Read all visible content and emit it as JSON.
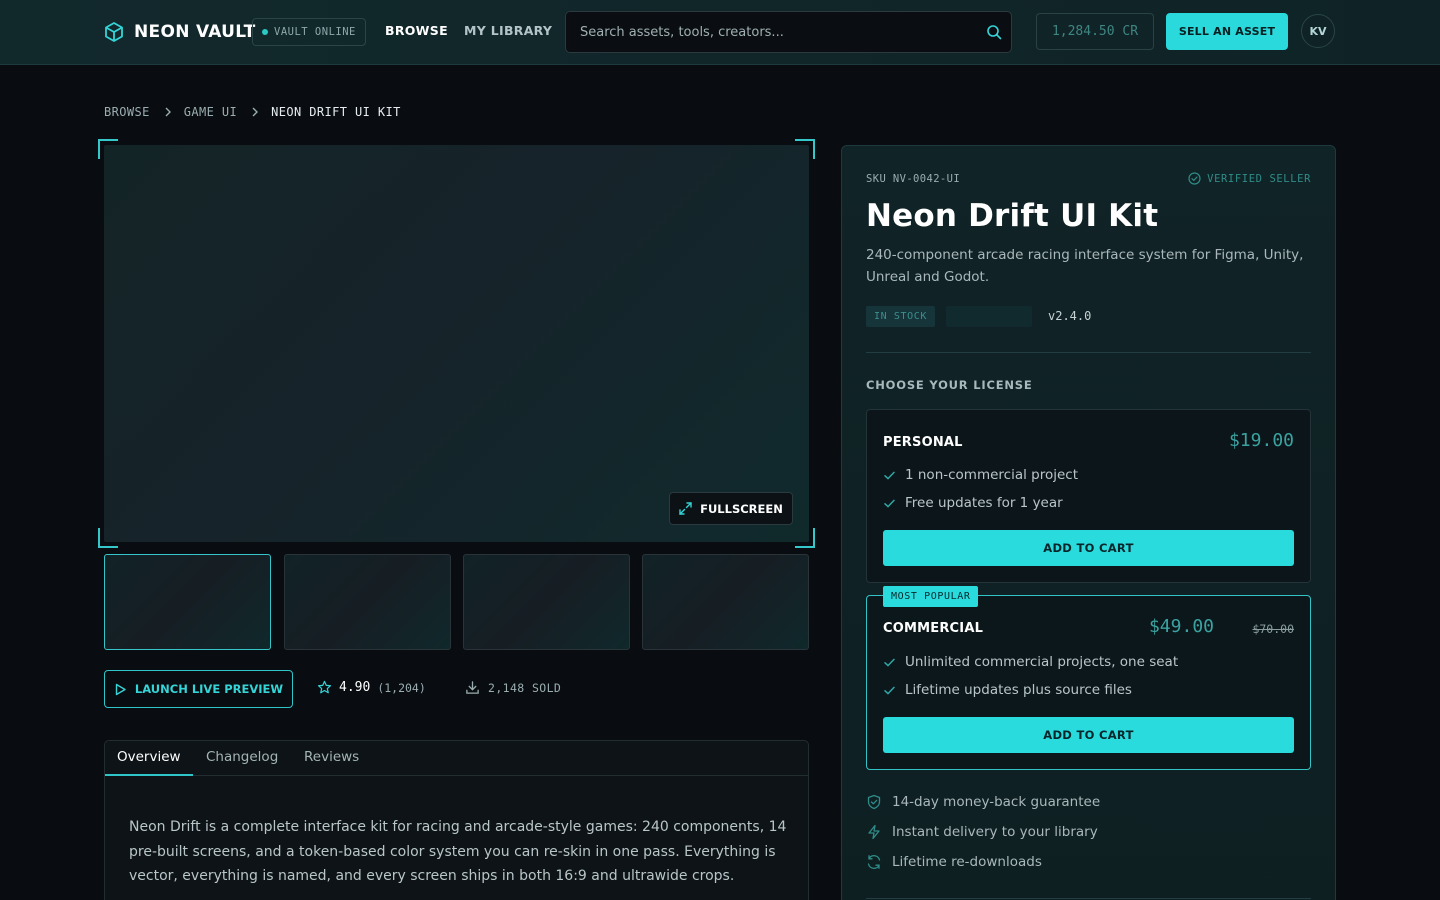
{
  "header": {
    "logo_text": "NEON VAULT",
    "status_badge": "VAULT ONLINE",
    "nav": {
      "browse": "BROWSE",
      "library": "MY LIBRARY"
    },
    "search_placeholder": "Search assets, tools, creators...",
    "credits": "1,284.50 CR",
    "sell_button": "SELL AN ASSET",
    "avatar_initials": "KV"
  },
  "breadcrumb": {
    "items": [
      "BROWSE",
      "GAME UI",
      "NEON DRIFT UI KIT"
    ]
  },
  "preview": {
    "fullscreen_label": "FULLSCREEN",
    "thumbnail_count": 4,
    "active_thumbnail": 1
  },
  "actions": {
    "live_preview": "LAUNCH LIVE PREVIEW",
    "rating": "4.90",
    "rating_count": "(1,204)",
    "sold": "2,148 SOLD"
  },
  "tabs": {
    "items": [
      "Overview",
      "Changelog",
      "Reviews"
    ],
    "active": "Overview",
    "overview_text": "Neon Drift is a complete interface kit for racing and arcade-style games: 240 components, 14 pre-built screens, and a token-based color system you can re-skin in one pass. Everything is vector, everything is named, and every screen ships in both 16:9 and ultrawide crops."
  },
  "product": {
    "sku": "SKU NV-0042-UI",
    "verified": "VERIFIED SELLER",
    "title": "Neon Drift UI Kit",
    "description": "240-component arcade racing interface system for Figma, Unity, Unreal and Godot.",
    "stock": "IN STOCK",
    "version": "v2.4.0",
    "license_heading": "CHOOSE YOUR LICENSE"
  },
  "licenses": {
    "personal": {
      "name": "PERSONAL",
      "price": "$19.00",
      "features": [
        "1 non-commercial project",
        "Free updates for 1 year"
      ],
      "cta": "ADD TO CART"
    },
    "commercial": {
      "badge": "MOST POPULAR",
      "name": "COMMERCIAL",
      "price": "$49.00",
      "old_price": "$70.00",
      "features": [
        "Unlimited commercial projects, one seat",
        "Lifetime updates plus source files"
      ],
      "cta": "ADD TO CART"
    }
  },
  "perks": [
    "14-day money-back guarantee",
    "Instant delivery to your library",
    "Lifetime re-downloads"
  ],
  "colors": {
    "accent": "#2adbde",
    "background": "#090c10",
    "panel": "#102326"
  }
}
